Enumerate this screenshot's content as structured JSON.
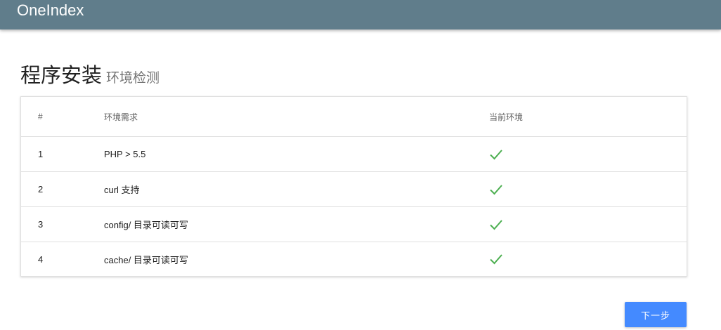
{
  "appbar": {
    "title": "OneIndex"
  },
  "heading": {
    "main": "程序安装",
    "sub": "环境检测"
  },
  "table": {
    "headers": {
      "num": "#",
      "requirement": "环境需求",
      "current": "当前环境"
    },
    "rows": [
      {
        "num": "1",
        "requirement": "PHP > 5.5",
        "current_icon": "check-icon",
        "passed": true
      },
      {
        "num": "2",
        "requirement": "curl 支持",
        "current_icon": "check-icon",
        "passed": true
      },
      {
        "num": "3",
        "requirement": "config/ 目录可读可写",
        "current_icon": "check-icon",
        "passed": true
      },
      {
        "num": "4",
        "requirement": "cache/ 目录可读可写",
        "current_icon": "check-icon",
        "passed": true
      }
    ]
  },
  "actions": {
    "next_label": "下一步"
  },
  "colors": {
    "appbar": "#607d8b",
    "check": "#4caf50",
    "primary_button": "#448aff"
  }
}
